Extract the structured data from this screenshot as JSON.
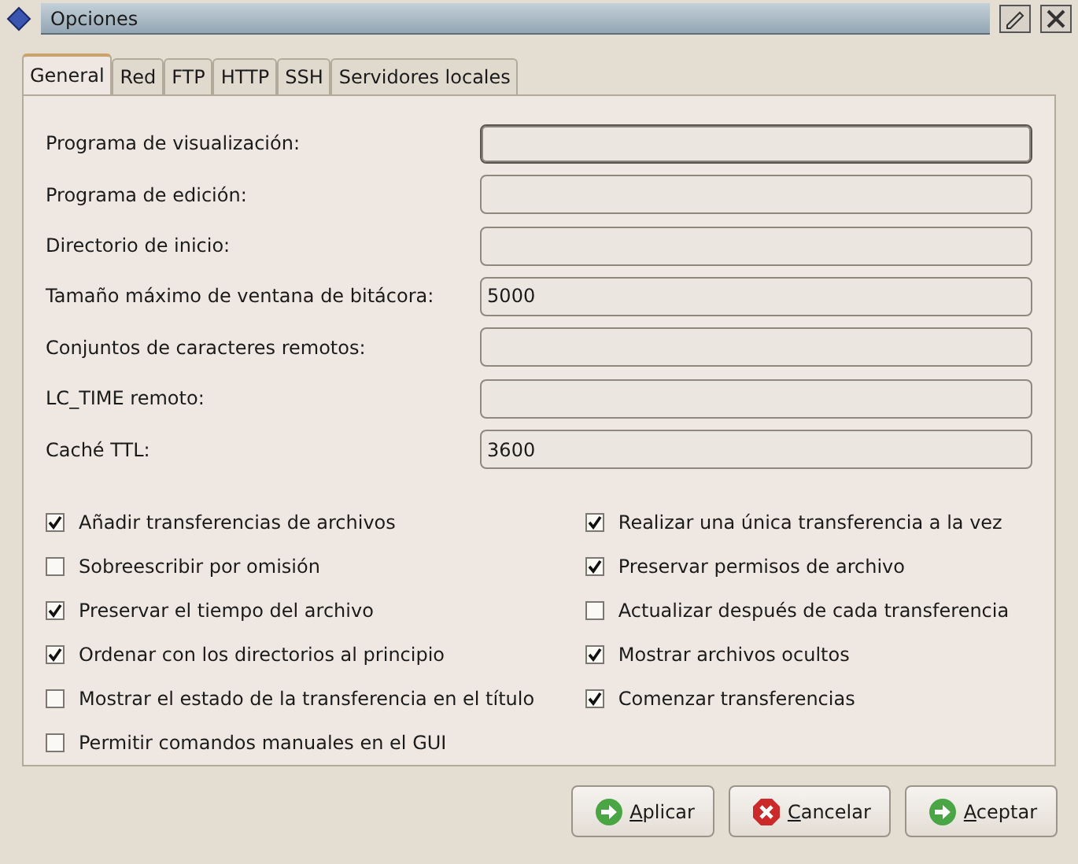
{
  "window": {
    "title": "Opciones"
  },
  "tabs": [
    {
      "label": "General",
      "selected": true
    },
    {
      "label": "Red",
      "selected": false
    },
    {
      "label": "FTP",
      "selected": false
    },
    {
      "label": "HTTP",
      "selected": false
    },
    {
      "label": "SSH",
      "selected": false
    },
    {
      "label": "Servidores locales",
      "selected": false
    }
  ],
  "fields": [
    {
      "label": "Programa de visualización:",
      "focused": true
    },
    {
      "label": "Programa de edición:",
      "focused": false
    },
    {
      "label": "Directorio de inicio:",
      "focused": false
    },
    {
      "label": "Tamaño máximo de ventana de bitácora:",
      "value": "5000",
      "focused": false
    },
    {
      "label": "Conjuntos de caracteres remotos:",
      "focused": false
    },
    {
      "label": "LC_TIME remoto:",
      "focused": false
    },
    {
      "label": "Caché TTL:",
      "value": "3600",
      "focused": false
    }
  ],
  "checkbox_columns": [
    [
      {
        "label": "Añadir transferencias de archivos",
        "checked": true
      },
      {
        "label": "Sobreescribir por omisión",
        "checked": false
      },
      {
        "label": "Preservar el tiempo del archivo",
        "checked": true
      },
      {
        "label": "Ordenar con los directorios al principio",
        "checked": true
      },
      {
        "label": "Mostrar el estado de la transferencia en el título",
        "checked": false
      },
      {
        "label": "Permitir comandos manuales en el GUI",
        "checked": false
      }
    ],
    [
      {
        "label": "Realizar una única transferencia a la vez",
        "checked": true
      },
      {
        "label": "Preservar permisos de archivo",
        "checked": true
      },
      {
        "label": "Actualizar después de cada transferencia",
        "checked": false
      },
      {
        "label": "Mostrar archivos ocultos",
        "checked": true
      },
      {
        "label": "Comenzar transferencias",
        "checked": true
      }
    ]
  ],
  "buttons": [
    {
      "label": "Aplicar",
      "kind": "go"
    },
    {
      "label": "Cancelar",
      "kind": "cancel"
    },
    {
      "label": "Aceptar",
      "kind": "go"
    }
  ]
}
